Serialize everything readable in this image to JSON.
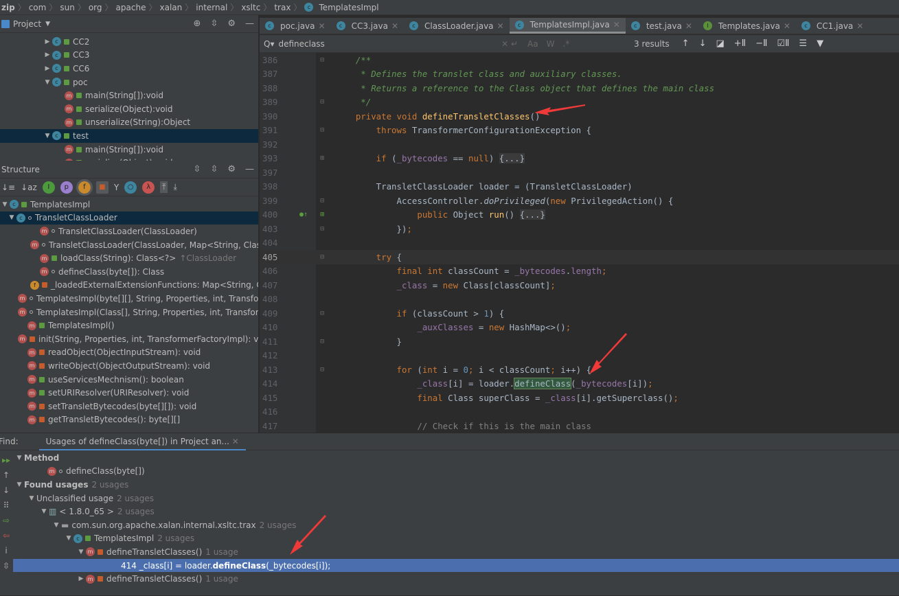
{
  "breadcrumb": [
    "zip",
    "com",
    "sun",
    "org",
    "apache",
    "xalan",
    "internal",
    "xsltc",
    "trax",
    "TemplatesImpl"
  ],
  "project": {
    "title": "Project",
    "items": [
      {
        "indent": 62,
        "tri": "▶",
        "icon": "c",
        "vis": "pub",
        "label": "CC2"
      },
      {
        "indent": 62,
        "tri": "▶",
        "icon": "c",
        "vis": "pub",
        "label": "CC3"
      },
      {
        "indent": 62,
        "tri": "▶",
        "icon": "c",
        "vis": "pub",
        "label": "CC6"
      },
      {
        "indent": 62,
        "tri": "▼",
        "icon": "c",
        "vis": "pub",
        "label": "poc"
      },
      {
        "indent": 80,
        "tri": "",
        "icon": "m",
        "vis": "pub",
        "label": "main(String[]):void"
      },
      {
        "indent": 80,
        "tri": "",
        "icon": "m",
        "vis": "pub",
        "label": "serialize(Object):void"
      },
      {
        "indent": 80,
        "tri": "",
        "icon": "m",
        "vis": "pub",
        "label": "unserialize(String):Object"
      },
      {
        "indent": 62,
        "tri": "▼",
        "icon": "c",
        "vis": "pub",
        "label": "test",
        "selected": true
      },
      {
        "indent": 80,
        "tri": "",
        "icon": "m",
        "vis": "pub",
        "label": "main(String[]):void"
      },
      {
        "indent": 80,
        "tri": "",
        "icon": "m",
        "vis": "pub",
        "label": "serialize(Object):void"
      }
    ]
  },
  "structure": {
    "title": "Structure",
    "items": [
      {
        "indent": 0,
        "tri": "▼",
        "icon": "c",
        "vis": "pub",
        "label": "TemplatesImpl"
      },
      {
        "indent": 10,
        "tri": "▼",
        "icon": "c",
        "vis": "pkg",
        "label": "TransletClassLoader",
        "selected": true
      },
      {
        "indent": 44,
        "tri": "",
        "icon": "m",
        "vis": "pkg",
        "label": "TransletClassLoader(ClassLoader)"
      },
      {
        "indent": 44,
        "tri": "",
        "icon": "m",
        "vis": "pkg",
        "label": "TransletClassLoader(ClassLoader, Map<String, Class"
      },
      {
        "indent": 44,
        "tri": "",
        "icon": "m",
        "vis": "pub",
        "label": "loadClass(String): Class<?>",
        "muted": "↑ClassLoader"
      },
      {
        "indent": 44,
        "tri": "",
        "icon": "m",
        "vis": "pkg",
        "label": "defineClass(byte[]): Class"
      },
      {
        "indent": 44,
        "tri": "",
        "icon": "f",
        "vis": "pri",
        "label": "_loadedExternalExtensionFunctions: Map<String, Cla"
      },
      {
        "indent": 26,
        "tri": "",
        "icon": "m",
        "vis": "pkg",
        "label": "TemplatesImpl(byte[][], String, Properties, int, Transform"
      },
      {
        "indent": 26,
        "tri": "",
        "icon": "m",
        "vis": "pkg",
        "label": "TemplatesImpl(Class[], String, Properties, int, Transform"
      },
      {
        "indent": 26,
        "tri": "",
        "icon": "m",
        "vis": "pub",
        "label": "TemplatesImpl()"
      },
      {
        "indent": 26,
        "tri": "",
        "icon": "m",
        "vis": "pri",
        "label": "init(String, Properties, int, TransformerFactoryImpl): voic"
      },
      {
        "indent": 26,
        "tri": "",
        "icon": "m",
        "vis": "pri",
        "label": "readObject(ObjectInputStream): void"
      },
      {
        "indent": 26,
        "tri": "",
        "icon": "m",
        "vis": "pri",
        "label": "writeObject(ObjectOutputStream): void"
      },
      {
        "indent": 26,
        "tri": "",
        "icon": "m",
        "vis": "pub",
        "label": "useServicesMechnism(): boolean"
      },
      {
        "indent": 26,
        "tri": "",
        "icon": "m",
        "vis": "pub",
        "label": "setURIResolver(URIResolver): void"
      },
      {
        "indent": 26,
        "tri": "",
        "icon": "m",
        "vis": "pri",
        "label": "setTransletBytecodes(byte[][]): void"
      },
      {
        "indent": 26,
        "tri": "",
        "icon": "m",
        "vis": "pri",
        "label": "getTransletBytecodes(): byte[][]"
      }
    ]
  },
  "tabs": [
    {
      "label": "poc.java",
      "icon": "c"
    },
    {
      "label": "CC3.java",
      "icon": "c"
    },
    {
      "label": "ClassLoader.java",
      "icon": "c"
    },
    {
      "label": "TemplatesImpl.java",
      "icon": "c",
      "active": true
    },
    {
      "label": "test.java",
      "icon": "c"
    },
    {
      "label": "Templates.java",
      "icon": "i"
    },
    {
      "label": "CC1.java",
      "icon": "c"
    }
  ],
  "search": {
    "query": "defineclass",
    "options": [
      "Aa",
      "W",
      ".*"
    ],
    "results": "3 results"
  },
  "code": [
    {
      "n": "386",
      "t": [
        [
          "doc",
          "    /**"
        ]
      ]
    },
    {
      "n": "387",
      "t": [
        [
          "doc",
          "     * Defines the translet class and auxiliary classes."
        ]
      ]
    },
    {
      "n": "388",
      "t": [
        [
          "doc",
          "     * Returns a reference to the Class object that defines the main class"
        ]
      ]
    },
    {
      "n": "389",
      "t": [
        [
          "doc",
          "     */"
        ]
      ]
    },
    {
      "n": "390",
      "t": [
        [
          "kw",
          "    private void "
        ],
        [
          "fn",
          "defineTransletClasses"
        ],
        [
          "pl",
          "()"
        ]
      ]
    },
    {
      "n": "391",
      "t": [
        [
          "kw",
          "        throws "
        ],
        [
          "pl",
          "TransformerConfigurationException {"
        ]
      ]
    },
    {
      "n": "392",
      "t": []
    },
    {
      "n": "393",
      "t": [
        [
          "kw",
          "        if "
        ],
        [
          "pl",
          "("
        ],
        [
          "fld",
          "_bytecodes"
        ],
        [
          "pl",
          " == "
        ],
        [
          "kw",
          "null"
        ],
        [
          "pl",
          ") "
        ],
        [
          "fold",
          "{...}"
        ]
      ]
    },
    {
      "n": "397",
      "t": []
    },
    {
      "n": "398",
      "t": [
        [
          "pl",
          "        TransletClassLoader loader = (TransletClassLoader)"
        ]
      ]
    },
    {
      "n": "399",
      "t": [
        [
          "pl",
          "            AccessController."
        ],
        [
          "pl it",
          "doPrivileged"
        ],
        [
          "pl",
          "("
        ],
        [
          "kw",
          "new "
        ],
        [
          "pl",
          "PrivilegedAction() {"
        ]
      ]
    },
    {
      "n": "400",
      "t": [
        [
          "kw",
          "                public "
        ],
        [
          "pl",
          "Object "
        ],
        [
          "fn",
          "run"
        ],
        [
          "pl",
          "() "
        ],
        [
          "fold",
          "{...}"
        ]
      ]
    },
    {
      "n": "403",
      "t": [
        [
          "pl",
          "            })"
        ],
        [
          "kw",
          ";"
        ]
      ]
    },
    {
      "n": "404",
      "t": []
    },
    {
      "n": "405",
      "cur": true,
      "t": [
        [
          "kw",
          "        try "
        ],
        [
          "pl",
          "{"
        ]
      ]
    },
    {
      "n": "406",
      "t": [
        [
          "kw",
          "            final int "
        ],
        [
          "pl",
          "classCount = "
        ],
        [
          "fld",
          "_bytecodes"
        ],
        [
          "pl",
          "."
        ],
        [
          "fld",
          "length"
        ],
        [
          "kw",
          ";"
        ]
      ]
    },
    {
      "n": "407",
      "t": [
        [
          "fld",
          "            _class"
        ],
        [
          "pl",
          " = "
        ],
        [
          "kw",
          "new "
        ],
        [
          "pl",
          "Class[classCount]"
        ],
        [
          "kw",
          ";"
        ]
      ]
    },
    {
      "n": "408",
      "t": []
    },
    {
      "n": "409",
      "t": [
        [
          "kw",
          "            if "
        ],
        [
          "pl",
          "(classCount > "
        ],
        [
          "num",
          "1"
        ],
        [
          "pl",
          ") {"
        ]
      ]
    },
    {
      "n": "410",
      "t": [
        [
          "fld",
          "                _auxClasses"
        ],
        [
          "pl",
          " = "
        ],
        [
          "kw",
          "new "
        ],
        [
          "pl",
          "HashMap<>()"
        ],
        [
          "kw",
          ";"
        ]
      ]
    },
    {
      "n": "411",
      "t": [
        [
          "pl",
          "            }"
        ]
      ]
    },
    {
      "n": "412",
      "t": []
    },
    {
      "n": "413",
      "t": [
        [
          "kw",
          "            for "
        ],
        [
          "pl",
          "("
        ],
        [
          "kw",
          "int "
        ],
        [
          "pl",
          "i = "
        ],
        [
          "num",
          "0"
        ],
        [
          "kw",
          "; "
        ],
        [
          "pl",
          "i < classCount"
        ],
        [
          "kw",
          "; "
        ],
        [
          "pl",
          "i++) {"
        ]
      ]
    },
    {
      "n": "414",
      "t": [
        [
          "fld",
          "                _class"
        ],
        [
          "pl",
          "[i] = loader."
        ],
        [
          "hl",
          "defineClass"
        ],
        [
          "pl",
          "("
        ],
        [
          "fld",
          "_bytecodes"
        ],
        [
          "pl",
          "[i])"
        ],
        [
          "kw",
          ";"
        ]
      ]
    },
    {
      "n": "415",
      "t": [
        [
          "kw",
          "                final "
        ],
        [
          "pl",
          "Class superClass = "
        ],
        [
          "fld",
          "_class"
        ],
        [
          "pl",
          "[i].getSuperclass()"
        ],
        [
          "kw",
          ";"
        ]
      ]
    },
    {
      "n": "416",
      "t": []
    },
    {
      "n": "417",
      "t": [
        [
          "cm",
          "                // Check if this is the main class"
        ]
      ]
    }
  ],
  "find": {
    "label": "Find:",
    "tab": "Usages of defineClass(byte[]) in Project an...",
    "items": [
      {
        "indent": 2,
        "tri": "▼",
        "label": "Method",
        "bold": true
      },
      {
        "indent": 36,
        "tri": "",
        "icon": "m",
        "vis": "pkg",
        "label": "defineClass(byte[])"
      },
      {
        "indent": 2,
        "tri": "▼",
        "label": "Found usages",
        "bold": true,
        "muted": "2 usages"
      },
      {
        "indent": 20,
        "tri": "▼",
        "label": "Unclassified usage",
        "muted": "2 usages"
      },
      {
        "indent": 38,
        "tri": "▼",
        "icon": "lib",
        "label": "< 1.8.0_65 >",
        "muted": "2 usages"
      },
      {
        "indent": 56,
        "tri": "▼",
        "icon": "pkg",
        "label": "com.sun.org.apache.xalan.internal.xsltc.trax",
        "muted": "2 usages"
      },
      {
        "indent": 74,
        "tri": "▼",
        "icon": "c",
        "vis": "pub",
        "label": "TemplatesImpl",
        "muted": "2 usages"
      },
      {
        "indent": 92,
        "tri": "▼",
        "icon": "m",
        "vis": "pri",
        "label": "defineTransletClasses()",
        "muted": "1 usage"
      },
      {
        "indent": 143,
        "tri": "",
        "label": "414 _class[i] = loader.",
        "strong": "defineClass",
        "tail": "(_bytecodes[i]);",
        "selected": true
      },
      {
        "indent": 92,
        "tri": "▶",
        "icon": "m",
        "vis": "pri",
        "label": "defineTransletClasses()",
        "muted": "1 usage"
      }
    ]
  },
  "annotation_color": "#f03a3a"
}
